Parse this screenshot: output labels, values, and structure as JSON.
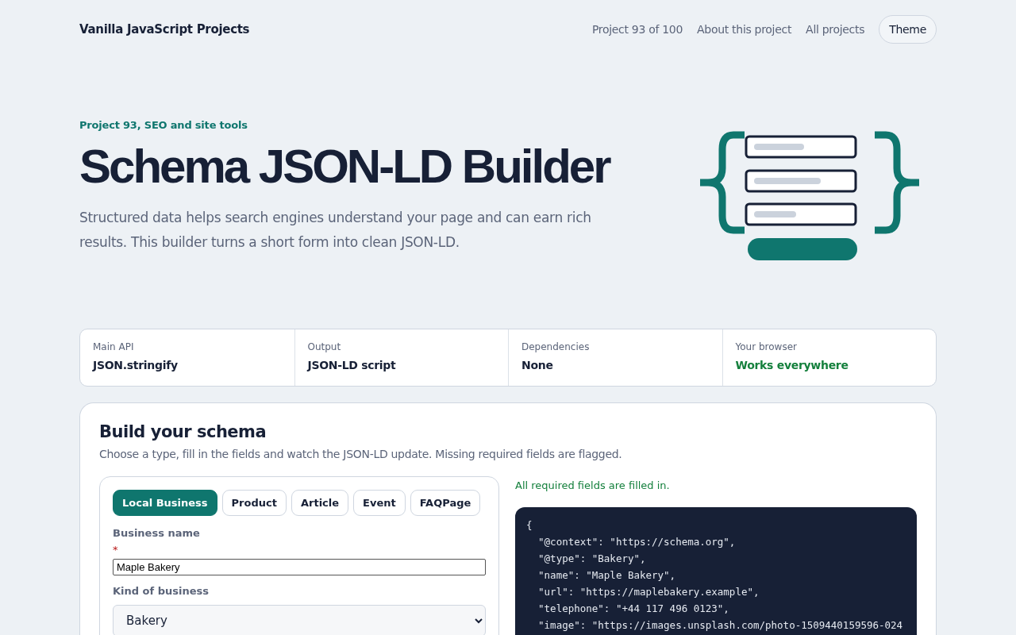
{
  "header": {
    "brand": "Vanilla JavaScript Projects",
    "nav": [
      {
        "label": "Project 93 of 100"
      },
      {
        "label": "About this project"
      },
      {
        "label": "All projects"
      }
    ],
    "theme_button": "Theme"
  },
  "hero": {
    "eyebrow": "Project 93, SEO and site tools",
    "title": "Schema JSON-LD Builder",
    "lead": "Structured data helps search engines understand your page and can earn rich results. This builder turns a short form into clean JSON-LD."
  },
  "facts": [
    {
      "label": "Main API",
      "value": "JSON.stringify",
      "positive": false
    },
    {
      "label": "Output",
      "value": "JSON-LD script",
      "positive": false
    },
    {
      "label": "Dependencies",
      "value": "None",
      "positive": false
    },
    {
      "label": "Your browser",
      "value": "Works everywhere",
      "positive": true
    }
  ],
  "builder": {
    "title": "Build your schema",
    "subtitle": "Choose a type, fill in the fields and watch the JSON-LD update. Missing required fields are flagged.",
    "tabs": [
      {
        "label": "Local Business",
        "selected": true
      },
      {
        "label": "Product",
        "selected": false
      },
      {
        "label": "Article",
        "selected": false
      },
      {
        "label": "Event",
        "selected": false
      },
      {
        "label": "FAQPage",
        "selected": false
      }
    ],
    "fields": [
      {
        "kind": "text",
        "label": "Business name",
        "required_mark": "*",
        "value": "Maple Bakery"
      },
      {
        "kind": "select",
        "label": "Kind of business",
        "value": "Bakery"
      }
    ],
    "status": "All required fields are filled in.",
    "code_lines": [
      "{",
      "  \"@context\": \"https://schema.org\",",
      "  \"@type\": \"Bakery\",",
      "  \"name\": \"Maple Bakery\",",
      "  \"url\": \"https://maplebakery.example\",",
      "  \"telephone\": \"+44 117 496 0123\",",
      "  \"image\": \"https://images.unsplash.com/photo-1509440159596-024"
    ]
  }
}
